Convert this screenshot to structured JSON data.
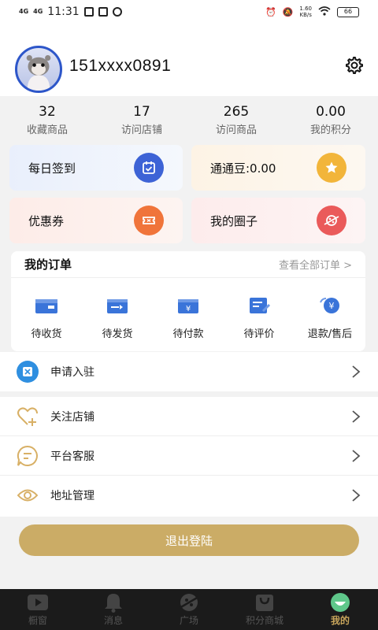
{
  "status_bar": {
    "signal1": "4G",
    "signal2": "4G",
    "time": "11:31",
    "net_speed_value": "1.60",
    "net_speed_unit": "KB/s",
    "battery": "66"
  },
  "profile": {
    "username": "151xxxx0891"
  },
  "stats": [
    {
      "value": "32",
      "label": "收藏商品"
    },
    {
      "value": "17",
      "label": "访问店铺"
    },
    {
      "value": "265",
      "label": "访问商品"
    },
    {
      "value": "0.00",
      "label": "我的积分"
    }
  ],
  "cards": {
    "sign_in": "每日签到",
    "beans": "通通豆:0.00",
    "coupon": "优惠券",
    "circle": "我的圈子"
  },
  "orders": {
    "title": "我的订单",
    "view_all": "查看全部订单 >",
    "items": [
      {
        "label": "待收货"
      },
      {
        "label": "待发货"
      },
      {
        "label": "待付款"
      },
      {
        "label": "待评价"
      },
      {
        "label": "退款/售后"
      }
    ]
  },
  "menu": {
    "apply": "申请入驻",
    "follow": "关注店铺",
    "service": "平台客服",
    "address": "地址管理"
  },
  "logout_label": "退出登陆",
  "tabs": [
    {
      "label": "橱窗"
    },
    {
      "label": "消息"
    },
    {
      "label": "广场"
    },
    {
      "label": "积分商城"
    },
    {
      "label": "我的"
    }
  ],
  "colors": {
    "accent": "#cbac66",
    "active_tab": "#c8a55b",
    "sign_icon": "#3d63d6",
    "bean_icon": "#f2b53a",
    "coupon_icon": "#f0743a",
    "circle_icon": "#ea5a5a",
    "order_icon": "#3a74d9",
    "apply_icon": "#2f8fe0",
    "menu_icon": "#d8b066"
  }
}
